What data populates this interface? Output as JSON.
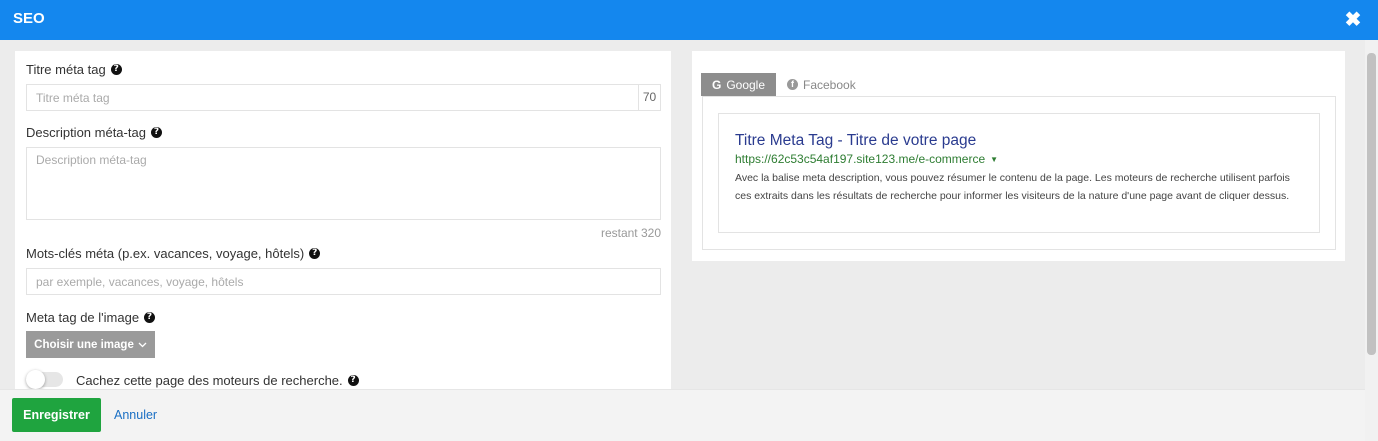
{
  "header": {
    "title": "SEO",
    "close_glyph": "✖",
    "bg_color": "#1487ee"
  },
  "form": {
    "meta_title_label": "Titre méta tag",
    "meta_title_placeholder": "Titre méta tag",
    "meta_title_counter": "70",
    "meta_desc_label": "Description méta-tag",
    "meta_desc_placeholder": "Description méta-tag",
    "meta_desc_remaining": "restant 320",
    "keywords_label": "Mots-clés méta (p.ex. vacances, voyage, hôtels)",
    "keywords_placeholder": "par exemple, vacances, voyage, hôtels",
    "image_label": "Meta tag de l'image",
    "choose_image_button": "Choisir une image",
    "hide_page_label": "Cachez cette page des moteurs de recherche.",
    "hide_page_enabled": false,
    "help_glyph": "?"
  },
  "preview": {
    "tabs": [
      {
        "label": "Google",
        "icon": "google-icon",
        "glyph": "G",
        "active": true
      },
      {
        "label": "Facebook",
        "icon": "facebook-icon",
        "glyph": "f",
        "active": false
      }
    ],
    "title": "Titre Meta Tag - Titre de votre page",
    "url": "https://62c53c54af197.site123.me/e-commerce",
    "url_caret": "▼",
    "description": "Avec la balise meta description, vous pouvez résumer le contenu de la page. Les moteurs de recherche utilisent parfois ces extraits dans les résultats de recherche pour informer les visiteurs de la nature d'une page avant de cliquer dessus."
  },
  "footer": {
    "save_label": "Enregistrer",
    "cancel_label": "Annuler",
    "save_color": "#1fa43f"
  }
}
